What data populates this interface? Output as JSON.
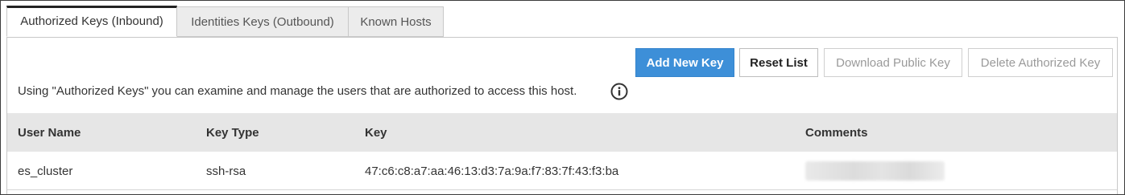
{
  "tabs": [
    {
      "label": "Authorized Keys (Inbound)",
      "active": true
    },
    {
      "label": "Identities Keys (Outbound)",
      "active": false
    },
    {
      "label": "Known Hosts",
      "active": false
    }
  ],
  "toolbar": {
    "add_new_key": "Add New Key",
    "reset_list": "Reset List",
    "download_public_key": "Download Public Key",
    "delete_authorized_key": "Delete Authorized Key"
  },
  "info": {
    "text": "Using \"Authorized Keys\" you can examine and manage the users that are authorized to access this host.",
    "icon": "info-icon"
  },
  "table": {
    "headers": [
      "User Name",
      "Key Type",
      "Key",
      "Comments"
    ],
    "rows": [
      {
        "user_name": "es_cluster",
        "key_type": "ssh-rsa",
        "key": "47:c6:c8:a7:aa:46:13:d3:7a:9a:f7:83:7f:43:f3:ba",
        "comments": ""
      }
    ]
  },
  "colors": {
    "primary": "#3d8fd8",
    "header_bg": "#e6e6e6",
    "disabled_text": "#9a9a9a"
  }
}
